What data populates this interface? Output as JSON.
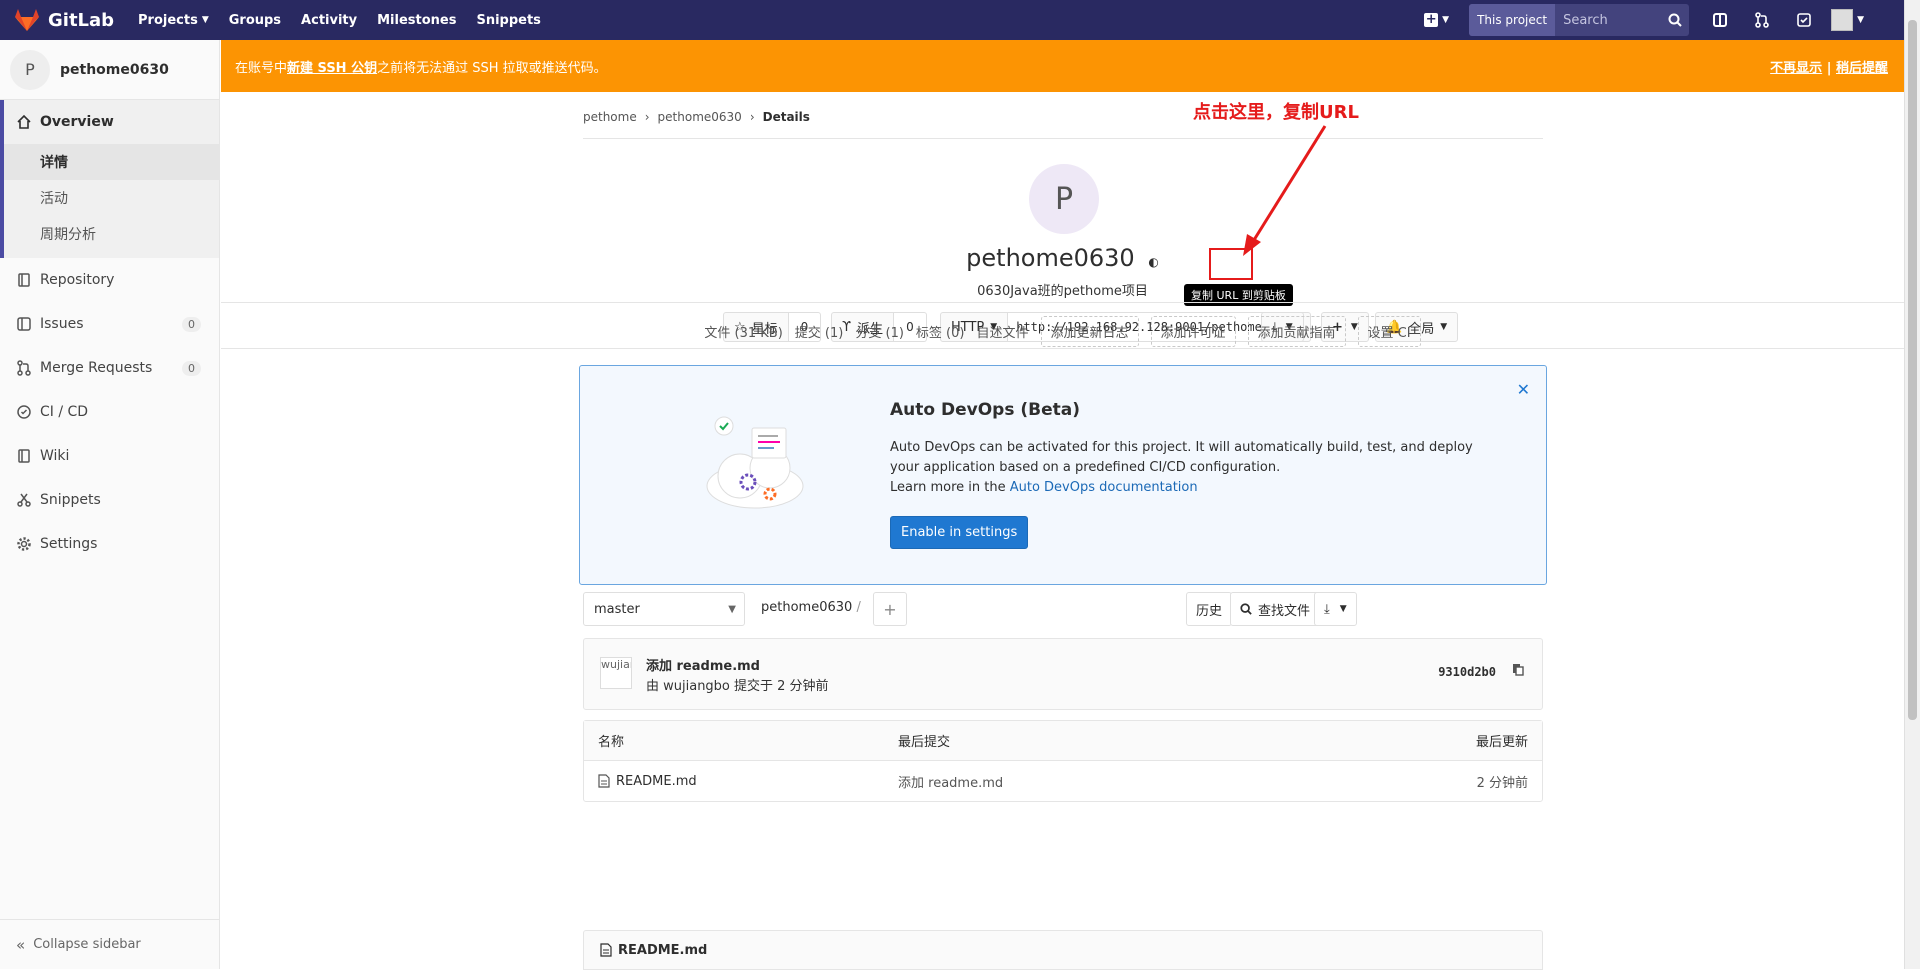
{
  "topbar": {
    "brand": "GitLab",
    "nav": [
      {
        "label": "Projects",
        "has_caret": true
      },
      {
        "label": "Groups"
      },
      {
        "label": "Activity"
      },
      {
        "label": "Milestones"
      },
      {
        "label": "Snippets"
      }
    ],
    "search_scope": "This project",
    "search_placeholder": "Search"
  },
  "sidebar": {
    "project_initial": "P",
    "project_name": "pethome0630",
    "overview_label": "Overview",
    "overview_sub": [
      "详情",
      "活动",
      "周期分析"
    ],
    "items": [
      {
        "label": "Repository",
        "icon": "repository-icon"
      },
      {
        "label": "Issues",
        "icon": "issues-icon",
        "count": "0"
      },
      {
        "label": "Merge Requests",
        "icon": "merge-request-icon",
        "count": "0"
      },
      {
        "label": "CI / CD",
        "icon": "ci-cd-icon"
      },
      {
        "label": "Wiki",
        "icon": "wiki-icon"
      },
      {
        "label": "Snippets",
        "icon": "snippets-icon"
      },
      {
        "label": "Settings",
        "icon": "settings-icon"
      }
    ],
    "collapse_label": "Collapse sidebar"
  },
  "banner": {
    "text_before": "在账号中 ",
    "link": "新建 SSH 公钥",
    "text_after": " 之前将无法通过 SSH 拉取或推送代码。",
    "dont_show": "不再显示",
    "sep": " | ",
    "remind_later": "稍后提醒",
    "color": "#fc9403"
  },
  "breadcrumb": [
    "pethome",
    "pethome0630",
    "Details"
  ],
  "project": {
    "initial": "P",
    "title": "pethome0630",
    "description": "0630Java班的pethome项目",
    "star_label": "星标",
    "star_count": "0",
    "fork_label": "派生",
    "fork_count": "0",
    "protocol": "HTTP",
    "clone_url": "http://192.168.92.128:9001/pethome/pethome0630.git",
    "notif_label": "全局",
    "copy_tooltip": "复制 URL 到剪贴板"
  },
  "annotation": {
    "text": "点击这里，复制URL",
    "color": "#e51b1b"
  },
  "stats": {
    "files": "文件 (31 KB)",
    "commits": "提交 (1)",
    "branches": "分支 (1)",
    "tags": "标签 (0)",
    "auto_files": "自述文件",
    "add_changelog": "添加更新日志",
    "add_license": "添加许可证",
    "add_contrib": "添加贡献指南",
    "setup_ci": "设置 CI"
  },
  "devops": {
    "title": "Auto DevOps (Beta)",
    "body": "Auto DevOps can be activated for this project. It will automatically build, test, and deploy your application based on a predefined CI/CD configuration.",
    "learn_prefix": "Learn more in the ",
    "learn_link": "Auto DevOps documentation",
    "button": "Enable in settings"
  },
  "tree": {
    "branch": "master",
    "path": "pethome0630",
    "path_sep": "/",
    "history": "历史",
    "find_file": "查找文件"
  },
  "commit": {
    "avatar_alt": "wujiangbo",
    "title": "添加 readme.md",
    "meta": "由 wujiangbo 提交于 2 分钟前",
    "sha": "9310d2b0"
  },
  "files": {
    "headers": [
      "名称",
      "最后提交",
      "最后更新"
    ],
    "rows": [
      {
        "name": "README.md",
        "commit": "添加 readme.md",
        "updated": "2 分钟前"
      }
    ]
  },
  "readme_title": "README.md"
}
